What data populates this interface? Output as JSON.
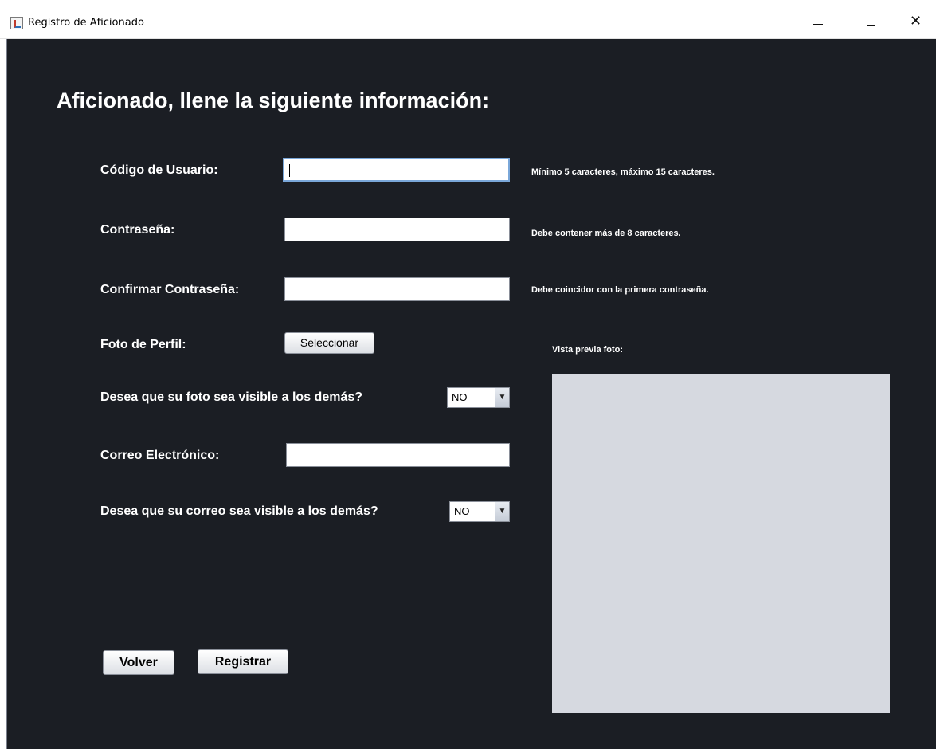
{
  "window": {
    "title": "Registro de Aficionado"
  },
  "heading": "Aficionado, llene la siguiente información:",
  "fields": {
    "codigo": {
      "label": "Código de Usuario:",
      "value": "",
      "hint": "Mínimo 5 caracteres, máximo 15 caracteres."
    },
    "contrasena": {
      "label": "Contraseña:",
      "value": "",
      "hint": "Debe contener más de 8 caracteres."
    },
    "confirmar": {
      "label": "Confirmar Contraseña:",
      "value": "",
      "hint": "Debe coincidor con la primera contraseña."
    },
    "foto": {
      "label": "Foto de Perfil:",
      "button": "Seleccionar"
    },
    "foto_visible": {
      "label": "Desea que su foto sea visible a los demás?",
      "selected": "NO"
    },
    "correo": {
      "label": "Correo Electrónico:",
      "value": ""
    },
    "correo_visible": {
      "label": "Desea que su correo sea visible a los demás?",
      "selected": "NO"
    }
  },
  "preview": {
    "label": "Vista previa foto:"
  },
  "actions": {
    "volver": "Volver",
    "registrar": "Registrar"
  },
  "colors": {
    "background": "#1b1e24",
    "preview": "#d6d9e0",
    "text": "#ffffff"
  }
}
